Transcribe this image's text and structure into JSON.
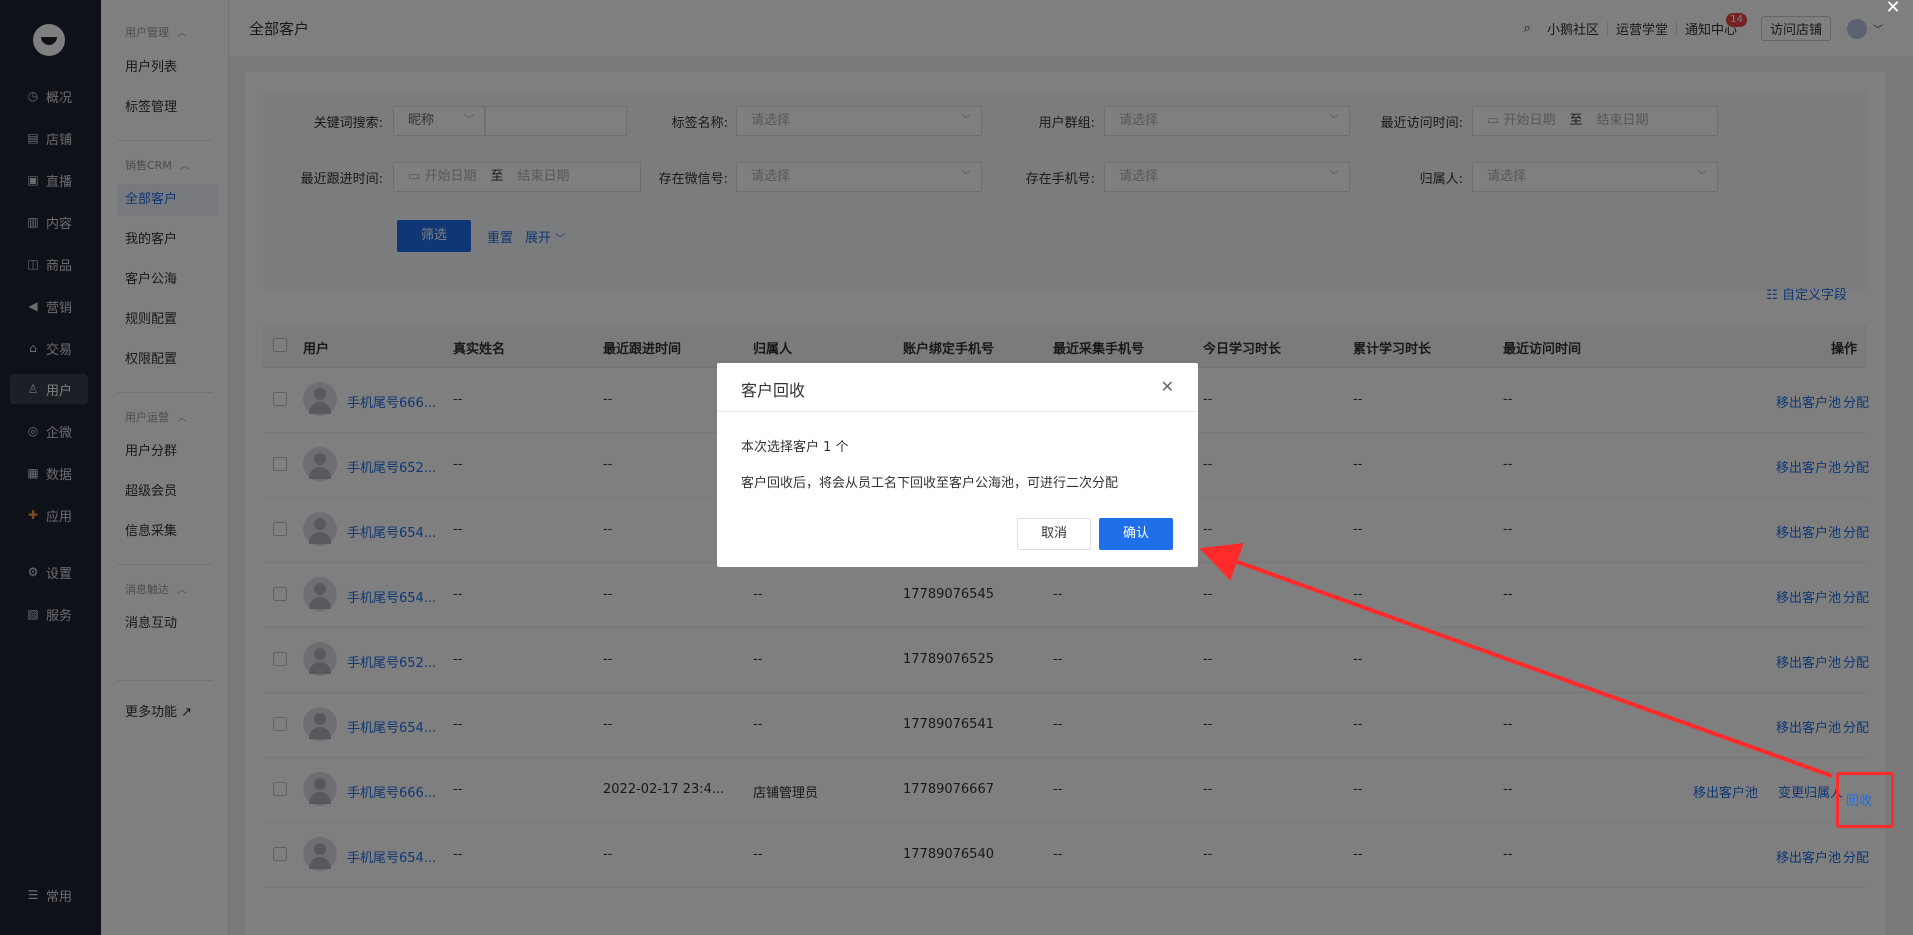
{
  "nav": {
    "items": [
      {
        "label": "概况",
        "icon": "clock-icon"
      },
      {
        "label": "店铺",
        "icon": "shop-icon"
      },
      {
        "label": "直播",
        "icon": "live-icon"
      },
      {
        "label": "内容",
        "icon": "content-icon"
      },
      {
        "label": "商品",
        "icon": "goods-icon"
      },
      {
        "label": "营销",
        "icon": "marketing-icon"
      },
      {
        "label": "交易",
        "icon": "trade-icon"
      },
      {
        "label": "用户",
        "icon": "user-icon"
      },
      {
        "label": "企微",
        "icon": "wecom-icon"
      },
      {
        "label": "数据",
        "icon": "data-icon"
      },
      {
        "label": "应用",
        "icon": "apps-icon"
      },
      {
        "label": "设置",
        "icon": "settings-icon"
      },
      {
        "label": "服务",
        "icon": "service-icon"
      }
    ],
    "bottom": "常用"
  },
  "submenu": {
    "group1": "用户管理",
    "g1_items": [
      "用户列表",
      "标签管理"
    ],
    "group2": "销售CRM",
    "g2_items": [
      "全部客户",
      "我的客户",
      "客户公海",
      "规则配置",
      "权限配置"
    ],
    "group3": "用户运营",
    "g3_items": [
      "用户分群",
      "超级会员",
      "信息采集"
    ],
    "group4": "消息触达",
    "g4_items": [
      "消息互动"
    ],
    "more": "更多功能"
  },
  "topbar": {
    "title": "全部客户",
    "community": "小鹅社区",
    "academy": "运营学堂",
    "notice": "通知中心",
    "notice_count": "14",
    "visit": "访问店铺"
  },
  "filters": {
    "keyword_label": "关键词搜索:",
    "keyword_type": "昵称",
    "tag_label": "标签名称:",
    "tag_ph": "请选择",
    "group_label": "用户群组:",
    "group_ph": "请选择",
    "visit_label": "最近访问时间:",
    "start_date": "开始日期",
    "to": "至",
    "end_date": "结束日期",
    "follow_label": "最近跟进时间:",
    "wechat_label": "存在微信号:",
    "wechat_ph": "请选择",
    "phone_label": "存在手机号:",
    "phone_ph": "请选择",
    "owner_label": "归属人:",
    "owner_ph": "请选择",
    "filter_btn": "筛选",
    "reset": "重置",
    "expand": "展开",
    "custom_fields": "自定义字段"
  },
  "table": {
    "headers": [
      "用户",
      "真实姓名",
      "最近跟进时间",
      "归属人",
      "账户绑定手机号",
      "最近采集手机号",
      "今日学习时长",
      "累计学习时长",
      "最近访问时间",
      "操作"
    ],
    "rows": [
      {
        "user": "手机尾号666...",
        "name": "--",
        "follow": "--",
        "owner": "",
        "phone": "",
        "collect": "",
        "today": "--",
        "total": "--",
        "visit": "--",
        "op1": "移出客户池",
        "op2": "分配"
      },
      {
        "user": "手机尾号652...",
        "name": "--",
        "follow": "--",
        "owner": "",
        "phone": "",
        "collect": "",
        "today": "--",
        "total": "--",
        "visit": "--",
        "op1": "移出客户池",
        "op2": "分配"
      },
      {
        "user": "手机尾号654...",
        "name": "--",
        "follow": "--",
        "owner": "",
        "phone": "",
        "collect": "",
        "today": "--",
        "total": "--",
        "visit": "--",
        "op1": "移出客户池",
        "op2": "分配"
      },
      {
        "user": "手机尾号654...",
        "name": "--",
        "follow": "--",
        "owner": "--",
        "phone": "17789076545",
        "collect": "--",
        "today": "--",
        "total": "--",
        "visit": "--",
        "op1": "移出客户池",
        "op2": "分配"
      },
      {
        "user": "手机尾号652...",
        "name": "--",
        "follow": "--",
        "owner": "--",
        "phone": "17789076525",
        "collect": "--",
        "today": "--",
        "total": "--",
        "visit": "--",
        "op1": "移出客户池",
        "op2": "分配"
      },
      {
        "user": "手机尾号654...",
        "name": "--",
        "follow": "--",
        "owner": "--",
        "phone": "17789076541",
        "collect": "--",
        "today": "--",
        "total": "--",
        "visit": "--",
        "op1": "移出客户池",
        "op2": "分配"
      },
      {
        "user": "手机尾号666...",
        "name": "--",
        "follow": "2022-02-17 23:4...",
        "owner": "店铺管理员",
        "phone": "17789076667",
        "collect": "--",
        "today": "--",
        "total": "--",
        "visit": "--",
        "op1": "移出客户池",
        "op2": "变更归属人",
        "op3": "回收"
      },
      {
        "user": "手机尾号654...",
        "name": "--",
        "follow": "--",
        "owner": "--",
        "phone": "17789076540",
        "collect": "--",
        "today": "--",
        "total": "--",
        "visit": "--",
        "op1": "移出客户池",
        "op2": "分配"
      }
    ]
  },
  "modal": {
    "title": "客户回收",
    "line1": "本次选择客户 1 个",
    "line2": "客户回收后，将会从员工名下回收至客户公海池，可进行二次分配",
    "cancel": "取消",
    "confirm": "确认"
  },
  "colors": {
    "primary": "#1f6feb",
    "annotation": "#ff2a2a"
  }
}
